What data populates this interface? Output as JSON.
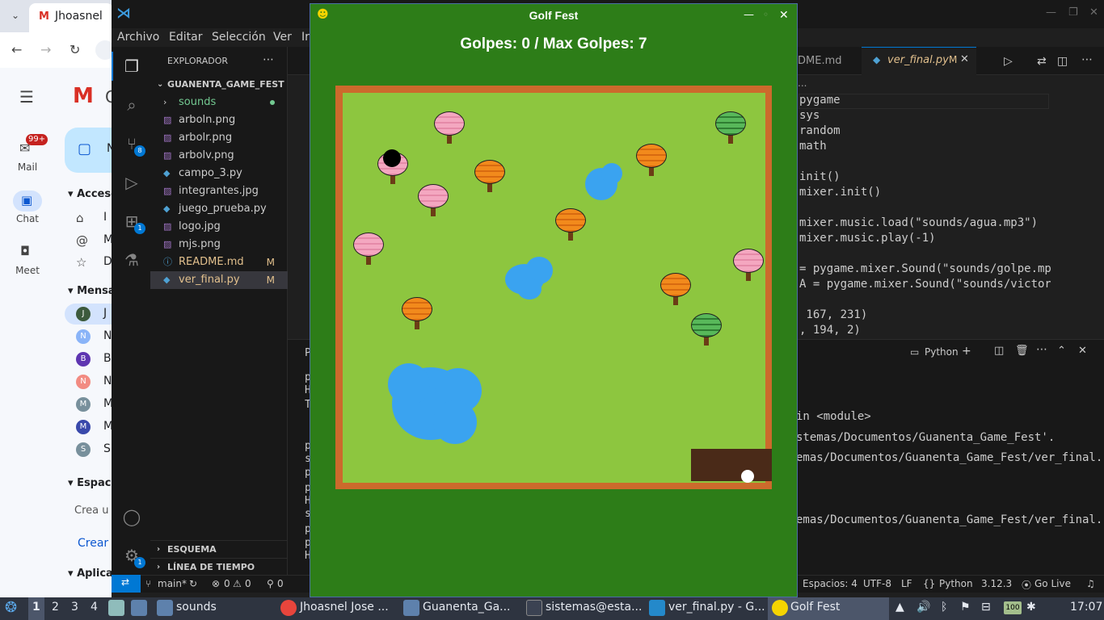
{
  "chrome": {
    "tab_title": "Jhoasnel",
    "gmail_letter": "G"
  },
  "gmail": {
    "mail_label": "Mail",
    "mail_badge": "99+",
    "chat_label": "Chat",
    "meet_label": "Meet",
    "accesos_label": "Acceso",
    "mensajes_label": "Mensaj",
    "espacios_label": "Espacio",
    "crea_label": "Crea u",
    "crear_label": "Crear",
    "aplicaciones_label": "Aplicac",
    "shortcut_letters": [
      "I",
      "M",
      "D"
    ],
    "contacts": [
      {
        "letter": "J",
        "color": "#3c5a3c"
      },
      {
        "letter": "N",
        "color": "#8ab4f8"
      },
      {
        "letter": "B",
        "color": "#5e35b1"
      },
      {
        "letter": "N",
        "color": "#f28b82"
      },
      {
        "letter": "M",
        "color": "#78909c"
      },
      {
        "letter": "M",
        "color": "#3949ab"
      },
      {
        "letter": "S",
        "color": "#78909c"
      }
    ]
  },
  "vscode": {
    "menu": [
      "Archivo",
      "Editar",
      "Selección",
      "Ver",
      "Ir"
    ],
    "explorer_title": "EXPLORADOR",
    "project_name": "GUANENTA_GAME_FEST",
    "files": [
      {
        "name": "sounds",
        "type": "folder",
        "status": "dot"
      },
      {
        "name": "arboln.png",
        "type": "image",
        "status": ""
      },
      {
        "name": "arbolr.png",
        "type": "image",
        "status": ""
      },
      {
        "name": "arbolv.png",
        "type": "image",
        "status": ""
      },
      {
        "name": "campo_3.py",
        "type": "python",
        "status": ""
      },
      {
        "name": "integrantes.jpg",
        "type": "image",
        "status": ""
      },
      {
        "name": "juego_prueba.py",
        "type": "python",
        "status": ""
      },
      {
        "name": "logo.jpg",
        "type": "image",
        "status": ""
      },
      {
        "name": "mjs.png",
        "type": "image",
        "status": ""
      },
      {
        "name": "README.md",
        "type": "info",
        "status": "M"
      },
      {
        "name": "ver_final.py",
        "type": "python",
        "status": "M"
      }
    ],
    "outline_label": "ESQUEMA",
    "timeline_label": "LÍNEA DE TIEMPO",
    "tab_readme": "DME.md",
    "tab_active": "ver_final.py",
    "tab_active_status": "M",
    "code_lines": [
      "pygame",
      "sys",
      "random",
      "math",
      "",
      "init()",
      "mixer.init()",
      "",
      "mixer.music.load(\"sounds/agua.mp3\")",
      "mixer.music.play(-1)",
      "",
      "= pygame.mixer.Sound(\"sounds/golpe.mp3",
      "A = pygame.mixer.Sound(\"sounds/victor",
      "",
      " 167, 231)",
      ", 194, 2)"
    ],
    "terminal_shell": "Python",
    "terminal_lines": [
      "in <module>",
      "stemas/Documentos/Guanenta_Game_Fest'.",
      "emas/Documentos/Guanenta_Game_Fest/ver_final.",
      "",
      "",
      "emas/Documentos/Guanenta_Game_Fest/ver_final."
    ],
    "left_panel_letters": [
      "P",
      "p",
      "H",
      "T",
      "p",
      "s",
      "p",
      "p",
      "H",
      "s",
      "p",
      "p",
      "H"
    ],
    "status": {
      "branch": "main*",
      "errors": "0",
      "warnings": "0",
      "ports": "0",
      "spaces": "Espacios: 4",
      "encoding": "UTF-8",
      "eol": "LF",
      "language": "Python",
      "version": "3.12.3",
      "golive": "Go Live"
    },
    "badges": {
      "scm": "8",
      "extensions": "1",
      "settings": "1"
    }
  },
  "game": {
    "title": "Golf Fest",
    "strokes_text": "Golpes: 0 / Max Golpes: 7",
    "colors": {
      "background": "#2d7d18",
      "border": "#cc6a2c",
      "grass": "#8dc63f",
      "water": "#3aa3f0",
      "sand": "#4a2a18"
    },
    "trees": [
      {
        "kind": "pink"
      },
      {
        "kind": "green"
      },
      {
        "kind": "orange"
      },
      {
        "kind": "pink"
      },
      {
        "kind": "orange"
      },
      {
        "kind": "pink"
      },
      {
        "kind": "orange"
      },
      {
        "kind": "pink"
      },
      {
        "kind": "pink"
      },
      {
        "kind": "orange"
      },
      {
        "kind": "orange"
      },
      {
        "kind": "green"
      }
    ]
  },
  "taskbar": {
    "workspaces": [
      "1",
      "2",
      "3",
      "4"
    ],
    "apps": [
      {
        "label": "sounds"
      },
      {
        "label": "Jhoasnel Jose ..."
      },
      {
        "label": "Guanenta_Ga..."
      },
      {
        "label": "sistemas@esta..."
      },
      {
        "label": "ver_final.py - G..."
      },
      {
        "label": "Golf Fest"
      }
    ],
    "battery": "100",
    "clock": "17:07"
  }
}
